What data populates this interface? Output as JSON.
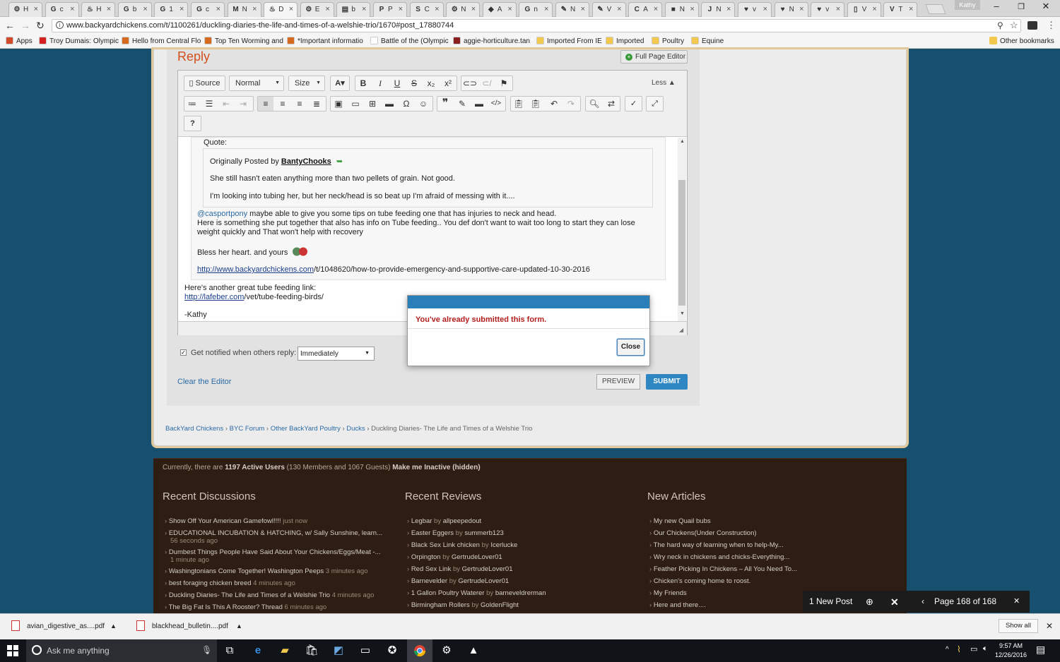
{
  "browser": {
    "tabs": [
      {
        "fav": "⚙",
        "label": "H",
        "active": false
      },
      {
        "fav": "G",
        "label": "c",
        "active": false
      },
      {
        "fav": "♨",
        "label": "H",
        "active": false
      },
      {
        "fav": "G",
        "label": "b",
        "active": false
      },
      {
        "fav": "G",
        "label": "1",
        "active": false
      },
      {
        "fav": "G",
        "label": "c",
        "active": false
      },
      {
        "fav": "M",
        "label": "N",
        "active": false
      },
      {
        "fav": "♨",
        "label": "D",
        "active": true
      },
      {
        "fav": "⚙",
        "label": "E",
        "active": false
      },
      {
        "fav": "▤",
        "label": "b",
        "active": false
      },
      {
        "fav": "P",
        "label": "P",
        "active": false
      },
      {
        "fav": "S",
        "label": "C",
        "active": false
      },
      {
        "fav": "⚙",
        "label": "N",
        "active": false
      },
      {
        "fav": "◆",
        "label": "A",
        "active": false
      },
      {
        "fav": "G",
        "label": "n",
        "active": false
      },
      {
        "fav": "✎",
        "label": "N",
        "active": false
      },
      {
        "fav": "✎",
        "label": "V",
        "active": false
      },
      {
        "fav": "C",
        "label": "A",
        "active": false
      },
      {
        "fav": "■",
        "label": "N",
        "active": false
      },
      {
        "fav": "J",
        "label": "N",
        "active": false
      },
      {
        "fav": "♥",
        "label": "v",
        "active": false
      },
      {
        "fav": "♥",
        "label": "N",
        "active": false
      },
      {
        "fav": "♥",
        "label": "v",
        "active": false
      },
      {
        "fav": "▯",
        "label": "V",
        "active": false
      },
      {
        "fav": "V",
        "label": "T",
        "active": false
      }
    ],
    "profile": "Kathy",
    "url": "www.backyardchickens.com/t/1100261/duckling-diaries-the-life-and-times-of-a-welshie-trio/1670#post_17880744",
    "bookmarks": [
      {
        "label": "Apps",
        "color": "#d04a2a"
      },
      {
        "label": "Troy Dumais: Olympic",
        "color": "#d61f1f"
      },
      {
        "label": "Hello from Central Flo",
        "color": "#d66a1f"
      },
      {
        "label": "Top Ten Worming and",
        "color": "#d66a1f"
      },
      {
        "label": "*Important informatio",
        "color": "#d66a1f"
      },
      {
        "label": "Battle of the (Olympic",
        "color": "#ffffff"
      },
      {
        "label": "aggie-horticulture.tan",
        "color": "#8a1f1f"
      },
      {
        "label": "Imported From IE",
        "color": "#f2c94c"
      },
      {
        "label": "Imported",
        "color": "#f2c94c"
      },
      {
        "label": "Poultry",
        "color": "#f2c94c"
      },
      {
        "label": "Equine",
        "color": "#f2c94c"
      }
    ],
    "other_bookmarks": "Other bookmarks"
  },
  "reply": {
    "title": "Reply",
    "full_page_editor": "Full Page Editor",
    "toolbar": {
      "source": "Source",
      "format": "Normal",
      "size": "Size",
      "less": "Less",
      "help": "?"
    },
    "quote_label": "Quote:",
    "originally_posted_by": "Originally Posted by",
    "quoted_author": "BantyChooks",
    "quote_line1": "She still hasn't eaten anything more than two pellets of grain. Not good.",
    "quote_line2": "I'm looking into tubing her, but her neck/head is so beat up I'm afraid of messing with it....",
    "mention": "@casportpony",
    "mention_text": "  maybe able to give you some tips on tube feeding one that has injuries to neck and head.",
    "para_line1": " Here is something she put together that also has info on Tube feeding.. You def don't want to wait too long to start they can lose",
    "para_line2": "weight quickly and That won't help with recovery",
    "bless": "Bless her heart. and yours",
    "link1_domain": "http://www.backyardchickens.com",
    "link1_rest": "/t/1048620/how-to-provide-emergency-and-supportive-care-updated-10-30-2016",
    "another": "Here's another great tube feeding link:",
    "link2_domain": "http://lafeber.com",
    "link2_rest": "/vet/tube-feeding-birds/",
    "signature": "-Kathy",
    "notify_label": "Get notified when others reply:",
    "notify_value": "Immediately",
    "clear": "Clear the Editor",
    "preview": "PREVIEW",
    "submit": "SUBMIT"
  },
  "breadcrumb": [
    "BackYard Chickens",
    "BYC Forum",
    "Other BackYard Poultry",
    "Ducks",
    "Duckling Diaries- The Life and Times of a Welshie Trio"
  ],
  "footer": {
    "active_pre": "Currently, there are",
    "active_count": "1197 Active Users",
    "active_mid": "(130 Members and 1067 Guests)",
    "inactive": "Make me Inactive (hidden)",
    "recent_discussions_title": "Recent Discussions",
    "recent_reviews_title": "Recent Reviews",
    "new_articles_title": "New Articles",
    "discussions": [
      {
        "t": "Show Off Your American Gamefowl!!!!",
        "m": "just now"
      },
      {
        "t": "EDUCATIONAL INCUBATION & HATCHING, w/ Sally Sunshine, learn...",
        "m": "56 seconds ago"
      },
      {
        "t": "Dumbest Things People Have Said About Your Chickens/Eggs/Meat -...",
        "m": "1 minute ago"
      },
      {
        "t": "Washingtonians Come Together! Washington Peeps",
        "m": "3 minutes ago"
      },
      {
        "t": "best foraging chicken breed",
        "m": "4 minutes ago"
      },
      {
        "t": "Duckling Diaries- The Life and Times of a Welshie Trio",
        "m": "4 minutes ago"
      },
      {
        "t": "The Big Fat Is This A Rooster? Thread",
        "m": "6 minutes ago"
      }
    ],
    "reviews": [
      {
        "t": "Legbar",
        "by": "allpeepedout"
      },
      {
        "t": "Easter Eggers",
        "by": "summerb123"
      },
      {
        "t": "Black Sex Link chicken",
        "by": "Icerlucke"
      },
      {
        "t": "Orpington",
        "by": "GertrudeLover01"
      },
      {
        "t": "Red Sex Link",
        "by": "GertrudeLover01"
      },
      {
        "t": "Barnevelder",
        "by": "GertrudeLover01"
      },
      {
        "t": "1 Gallon Poultry Waterer",
        "by": "barneveldrerman"
      },
      {
        "t": "Birmingham Rollers",
        "by": "GoldenFlight"
      }
    ],
    "by_word": "by",
    "articles": [
      "My new Quail bubs",
      "Our Chickens(Under Construction)",
      "The hard way of learning when to help-My...",
      "Wry neck in chickens and chicks-Everything...",
      "Feather Picking In Chickens – All You Need To...",
      "Chicken's coming home to roost.",
      "My Friends",
      "Here and there...."
    ]
  },
  "modal": {
    "message": "You've already submitted this form.",
    "close": "Close"
  },
  "page_nav": {
    "new_post": "1 New Post",
    "page_label": "Page 168 of 168"
  },
  "downloads": {
    "file1": "avian_digestive_as....pdf",
    "file2": "blackhead_bulletin....pdf",
    "show_all": "Show all"
  },
  "taskbar": {
    "search_placeholder": "Ask me anything",
    "time": "9:57 AM",
    "date": "12/26/2016"
  }
}
